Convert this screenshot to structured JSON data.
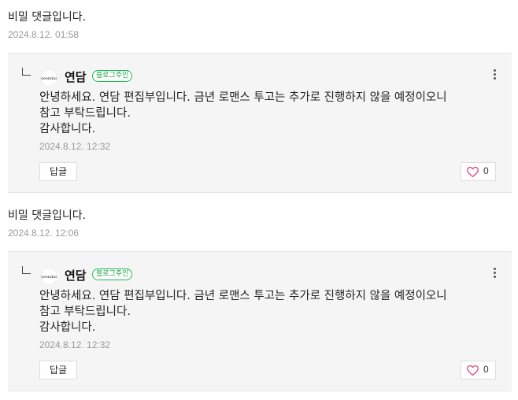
{
  "comments": [
    {
      "text": "비밀 댓글입니다.",
      "date": "2024.8.12. 01:58",
      "reply": {
        "avatar_text": "yeondam",
        "author": "연담",
        "badge": "블로그주인",
        "lines": [
          "안녕하세요. 연담 편집부입니다. 금년 로맨스 투고는 추가로 진행하지 않을 예정이오니",
          "참고 부탁드립니다.",
          "감사합니다."
        ],
        "date": "2024.8.12. 12:32",
        "reply_label": "답글",
        "like_count": "0"
      }
    },
    {
      "text": "비밀 댓글입니다.",
      "date": "2024.8.12. 12:06",
      "reply": {
        "avatar_text": "yeondam",
        "author": "연담",
        "badge": "블로그주인",
        "lines": [
          "안녕하세요. 연담 편집부입니다. 금년 로맨스 투고는 추가로 진행하지 않을 예정이오니",
          "참고 부탁드립니다.",
          "감사합니다."
        ],
        "date": "2024.8.12. 12:32",
        "reply_label": "답글",
        "like_count": "0"
      }
    }
  ],
  "colors": {
    "badge_green": "#1db954",
    "heart": "#e0457b"
  }
}
